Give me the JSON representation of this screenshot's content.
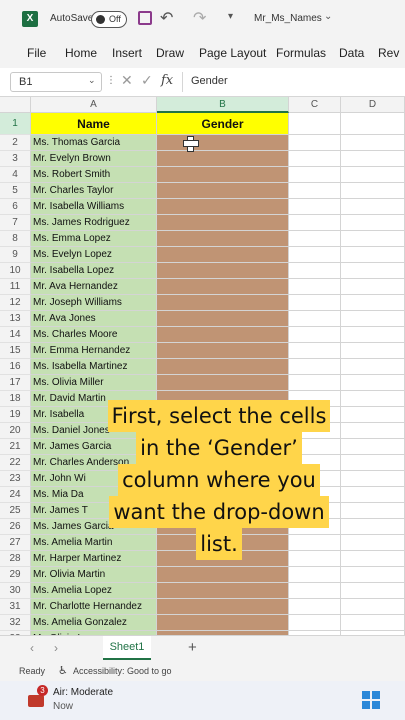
{
  "titlebar": {
    "autosave_label": "AutoSave",
    "autosave_state": "Off",
    "filename": "Mr_Ms_Names"
  },
  "ribbon": {
    "tabs": [
      "File",
      "Home",
      "Insert",
      "Draw",
      "Page Layout",
      "Formulas",
      "Data",
      "Rev"
    ]
  },
  "formula_bar": {
    "name_box": "B1",
    "fx": "fx",
    "content": "Gender"
  },
  "columns": [
    "A",
    "B",
    "C",
    "D"
  ],
  "header_row": {
    "row": "1",
    "a": "Name",
    "b": "Gender"
  },
  "rows": [
    {
      "n": "2",
      "name": "Ms. Thomas Garcia"
    },
    {
      "n": "3",
      "name": "Mr. Evelyn Brown"
    },
    {
      "n": "4",
      "name": "Ms. Robert Smith"
    },
    {
      "n": "5",
      "name": "Mr. Charles Taylor"
    },
    {
      "n": "6",
      "name": "Mr. Isabella Williams"
    },
    {
      "n": "7",
      "name": "Ms. James Rodriguez"
    },
    {
      "n": "8",
      "name": "Ms. Emma Lopez"
    },
    {
      "n": "9",
      "name": "Ms. Evelyn Lopez"
    },
    {
      "n": "10",
      "name": "Mr. Isabella Lopez"
    },
    {
      "n": "11",
      "name": "Mr. Ava Hernandez"
    },
    {
      "n": "12",
      "name": "Mr. Joseph Williams"
    },
    {
      "n": "13",
      "name": "Mr. Ava Jones"
    },
    {
      "n": "14",
      "name": "Ms. Charles Moore"
    },
    {
      "n": "15",
      "name": "Mr. Emma Hernandez"
    },
    {
      "n": "16",
      "name": "Ms. Isabella Martinez"
    },
    {
      "n": "17",
      "name": "Ms. Olivia Miller"
    },
    {
      "n": "18",
      "name": "Mr. David Martin"
    },
    {
      "n": "19",
      "name": "Mr. Isabella"
    },
    {
      "n": "20",
      "name": "Ms. Daniel Jones"
    },
    {
      "n": "21",
      "name": "Mr. James Garcia"
    },
    {
      "n": "22",
      "name": "Mr. Charles Anderson"
    },
    {
      "n": "23",
      "name": "Mr. John Wi"
    },
    {
      "n": "24",
      "name": "Ms. Mia Da"
    },
    {
      "n": "25",
      "name": "Mr. James T"
    },
    {
      "n": "26",
      "name": "Ms. James Garcia"
    },
    {
      "n": "27",
      "name": "Ms. Amelia Martin"
    },
    {
      "n": "28",
      "name": "Mr. Harper Martinez"
    },
    {
      "n": "29",
      "name": "Mr. Olivia Martin"
    },
    {
      "n": "30",
      "name": "Ms. Amelia Lopez"
    },
    {
      "n": "31",
      "name": "Mr. Charlotte Hernandez"
    },
    {
      "n": "32",
      "name": "Ms. Amelia Gonzalez"
    },
    {
      "n": "33",
      "name": "Mr. Olivia Lopez"
    }
  ],
  "caption_lines": [
    "First, select the cells",
    "in the ‘Gender’",
    "column where you",
    "want the drop-down",
    "list."
  ],
  "sheet_tabs": {
    "active": "Sheet1",
    "add": "+"
  },
  "status": {
    "ready": "Ready",
    "accessibility": "Accessibility: Good to go"
  },
  "taskbar": {
    "weather_badge": "3",
    "weather_title": "Air: Moderate",
    "weather_sub": "Now"
  },
  "colors": {
    "name_fill": "#c5e0b3",
    "gender_fill": "#c09474",
    "header_fill": "#ffff00",
    "caption_bg": "#ffd54a",
    "excel_green": "#217346"
  }
}
